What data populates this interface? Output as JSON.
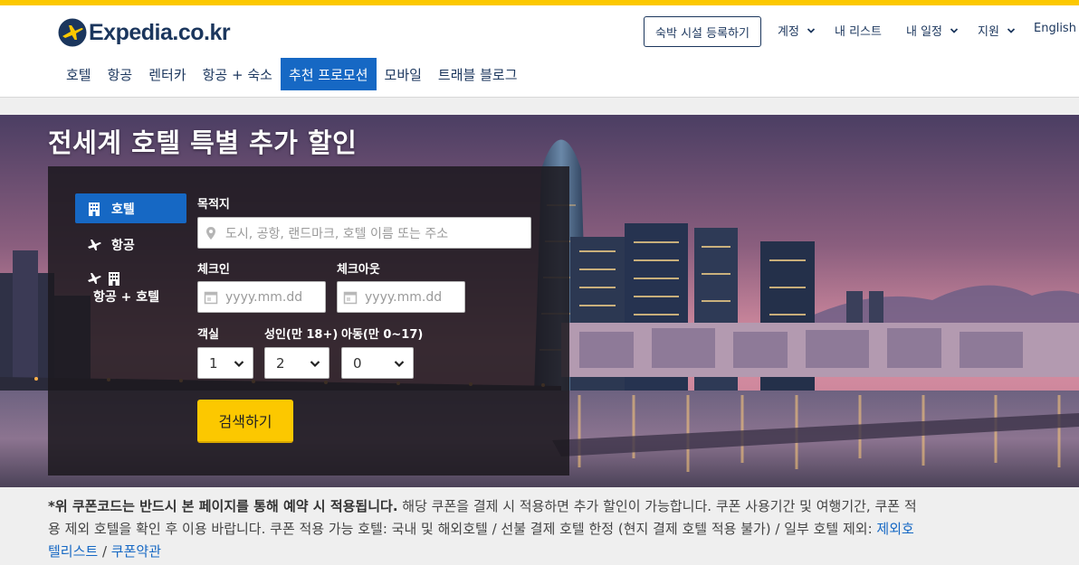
{
  "header": {
    "logo_text": "Expedia.co.kr",
    "list_property_label": "숙박 시설 등록하기",
    "account_label": "계정",
    "mylist_label": "내 리스트",
    "trips_label": "내 일정",
    "support_label": "지원",
    "language_label": "English"
  },
  "nav": {
    "items": [
      "호텔",
      "항공",
      "렌터카",
      "항공 + 숙소",
      "추천 프로모션",
      "모바일",
      "트래블 블로그"
    ],
    "active": "추천 프로모션"
  },
  "hero": {
    "title": "전세계 호텔 특별 추가 할인"
  },
  "search": {
    "tabs": [
      {
        "label": "호텔",
        "icon": "hotel-icon",
        "active": true
      },
      {
        "label": "항공",
        "icon": "plane-icon",
        "active": false
      },
      {
        "label": "항공 + 호텔",
        "icon": "plane-hotel-icon",
        "active": false
      }
    ],
    "destination_label": "목적지",
    "destination_placeholder": "도시, 공항, 랜드마크, 호텔 이름 또는 주소",
    "checkin_label": "체크인",
    "checkin_placeholder": "yyyy.mm.dd",
    "checkout_label": "체크아웃",
    "checkout_placeholder": "yyyy.mm.dd",
    "rooms_label": "객실",
    "rooms_value": "1",
    "adults_label": "성인(만 18+)",
    "adults_value": "2",
    "children_label": "아동(만 0~17)",
    "children_value": "0",
    "search_button": "검색하기"
  },
  "disclaimer": {
    "bold": "*위 쿠폰코드는 반드시 본 페이지를 통해 예약 시 적용됩니다.",
    "line1_rest": " 해당 쿠폰을 결제 시 적용하면 추가 할인이 가능합니다. 쿠폰 사용기간 및 여행기간, 쿠폰 적",
    "line2": "용 제외 호텔을 확인 후 이용 바랍니다. 쿠폰 적용 가능 호텔: 국내 및 해외호텔 / 선불 결제 호텔 한정 (현지 결제 호텔 적용 불가) / 일부 호텔 제외: ",
    "link_excluded_part1": "제외호",
    "link_excluded_part2": "텔리스트",
    "separator": " / ",
    "link_terms": "쿠폰약관"
  },
  "colors": {
    "brand_navy": "#1b365d",
    "accent_blue": "#1668c4",
    "brand_yellow": "#fcc800"
  }
}
